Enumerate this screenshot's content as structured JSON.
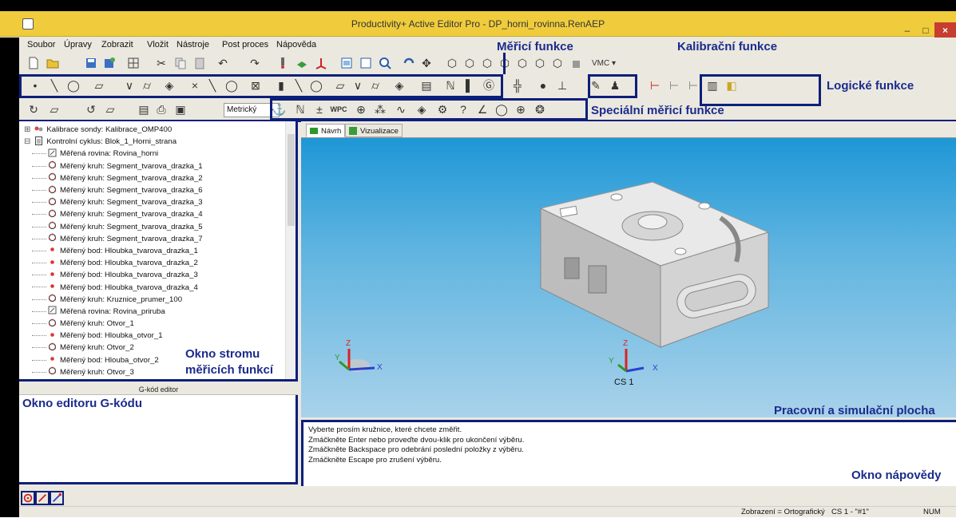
{
  "window": {
    "title": "Productivity+ Active Editor Pro - DP_horni_rovinna.RenAEP",
    "min_label": "–",
    "max_label": "□",
    "close_label": "×"
  },
  "menu": [
    "Soubor",
    "Úpravy",
    "Zobrazit",
    "Vložit",
    "Nástroje",
    "Post proces",
    "Nápověda"
  ],
  "toolbar": {
    "vmc_label": "VMC ▾",
    "units_select": "Metrický"
  },
  "annotations": {
    "mereni": "Měřicí funkce",
    "kalibrace": "Kalibrační funkce",
    "logicke": "Logické funkce",
    "specialni": "Speciální měřicí funkce",
    "okno_stromu_1": "Okno stromu",
    "okno_stromu_2": "měřicích funkcí",
    "okno_editoru": "Okno editoru G-kódu",
    "pracovni": "Pracovní a simulační plocha",
    "okno_napovedy": "Okno nápovědy"
  },
  "tree": [
    {
      "indent": 0,
      "toggle": "⊞",
      "icon": "probe-icon",
      "label": "Kalibrace sondy: Kalibrace_OMP400"
    },
    {
      "indent": 0,
      "toggle": "⊟",
      "icon": "document-icon",
      "label": "Kontrolní cyklus: Blok_1_Horni_strana"
    },
    {
      "indent": 1,
      "icon": "plane-icon",
      "label": "Měřená rovina: Rovina_horni"
    },
    {
      "indent": 1,
      "icon": "circle-icon",
      "label": "Měřený kruh: Segment_tvarova_drazka_1"
    },
    {
      "indent": 1,
      "icon": "circle-icon",
      "label": "Měřený kruh: Segment_tvarova_drazka_2"
    },
    {
      "indent": 1,
      "icon": "circle-icon",
      "label": "Měřený kruh: Segment_tvarova_drazka_6"
    },
    {
      "indent": 1,
      "icon": "circle-icon",
      "label": "Měřený kruh: Segment_tvarova_drazka_3"
    },
    {
      "indent": 1,
      "icon": "circle-icon",
      "label": "Měřený kruh: Segment_tvarova_drazka_4"
    },
    {
      "indent": 1,
      "icon": "circle-icon",
      "label": "Měřený kruh: Segment_tvarova_drazka_5"
    },
    {
      "indent": 1,
      "icon": "circle-icon",
      "label": "Měřený kruh: Segment_tvarova_drazka_7"
    },
    {
      "indent": 1,
      "icon": "point-icon",
      "label": "Měřený bod: Hloubka_tvarova_drazka_1"
    },
    {
      "indent": 1,
      "icon": "point-icon",
      "label": "Měřený bod: Hloubka_tvarova_drazka_2"
    },
    {
      "indent": 1,
      "icon": "point-icon",
      "label": "Měřený bod: Hloubka_tvarova_drazka_3"
    },
    {
      "indent": 1,
      "icon": "point-icon",
      "label": "Měřený bod: Hloubka_tvarova_drazka_4"
    },
    {
      "indent": 1,
      "icon": "circle-icon",
      "label": "Měřený kruh: Kruznice_prumer_100"
    },
    {
      "indent": 1,
      "icon": "plane-icon",
      "label": "Měřená rovina: Rovina_priruba"
    },
    {
      "indent": 1,
      "icon": "circle-icon",
      "label": "Měřený kruh: Otvor_1"
    },
    {
      "indent": 1,
      "icon": "point-icon",
      "label": "Měřený bod: Hloubka_otvor_1"
    },
    {
      "indent": 1,
      "icon": "circle-icon",
      "label": "Měřený kruh: Otvor_2"
    },
    {
      "indent": 1,
      "icon": "point-icon",
      "label": "Měřený bod: Hlouba_otvor_2"
    },
    {
      "indent": 1,
      "icon": "circle-icon",
      "label": "Měřený kruh: Otvor_3"
    }
  ],
  "gcode_editor": {
    "title": "G-kód editor"
  },
  "view_tabs": [
    "Návrh",
    "Vizualizace"
  ],
  "coord_label": "CS 1",
  "help_lines": [
    "Vyberte prosím kružnice, které chcete změřit.",
    "Zmáčkněte Enter nebo proveďte dvou-klik pro ukončení výběru.",
    "Zmáčkněte Backspace pro odebrání poslední položky z výběru.",
    "Zmáčkněte Escape pro zrušení výběru."
  ],
  "status": {
    "view_mode": "Zobrazení = Ortografický",
    "cs": "CS 1 - \"#1\"",
    "num": "NUM"
  },
  "colors": {
    "title_bar": "#f0cc3d",
    "annotation": "#0c1f7a",
    "view_top": "#1e97d6",
    "view_bottom": "#a9d2ea"
  }
}
